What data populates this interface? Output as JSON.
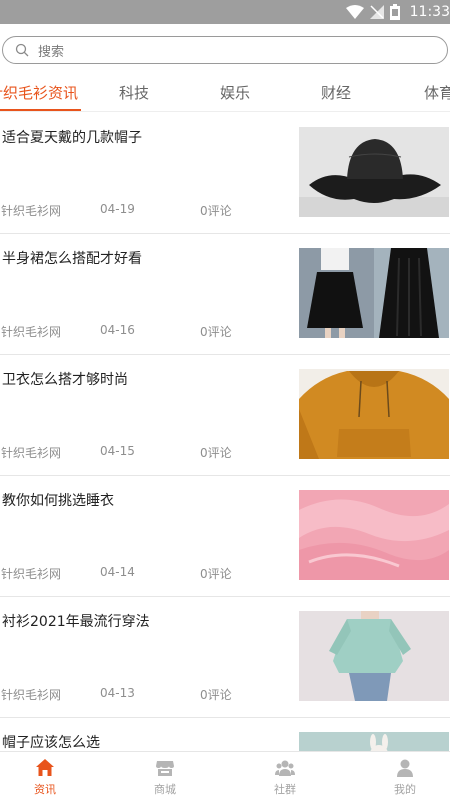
{
  "status_bar": {
    "time": "11:33"
  },
  "search": {
    "placeholder": "搜索"
  },
  "tabs": [
    {
      "label": "针织毛衫资讯",
      "active": true
    },
    {
      "label": "科技",
      "active": false
    },
    {
      "label": "娱乐",
      "active": false
    },
    {
      "label": "财经",
      "active": false
    },
    {
      "label": "体育",
      "active": false
    }
  ],
  "feed": [
    {
      "title": "适合夏天戴的几款帽子",
      "source": "针织毛衫网",
      "date": "04-19",
      "comments": "0评论",
      "image": "black-hat-photo"
    },
    {
      "title": "半身裙怎么搭配才好看",
      "source": "针织毛衫网",
      "date": "04-16",
      "comments": "0评论",
      "image": "skirt-outfit-photo"
    },
    {
      "title": "卫衣怎么搭才够时尚",
      "source": "针织毛衫网",
      "date": "04-15",
      "comments": "0评论",
      "image": "mustard-hoodie-photo"
    },
    {
      "title": "教你如何挑选睡衣",
      "source": "针织毛衫网",
      "date": "04-14",
      "comments": "0评论",
      "image": "pink-fleece-photo"
    },
    {
      "title": "衬衫2021年最流行穿法",
      "source": "针织毛衫网",
      "date": "04-13",
      "comments": "0评论",
      "image": "green-shirt-photo"
    },
    {
      "title": "帽子应该怎么选",
      "image": "bunny-hat-photo"
    }
  ],
  "bottom_nav": [
    {
      "label": "资讯",
      "icon": "home-icon",
      "active": true
    },
    {
      "label": "商城",
      "icon": "store-icon",
      "active": false
    },
    {
      "label": "社群",
      "icon": "community-icon",
      "active": false
    },
    {
      "label": "我的",
      "icon": "profile-icon",
      "active": false
    }
  ],
  "colors": {
    "accent": "#e8541c",
    "inactive": "#a3a3a3",
    "status_bar": "#9e9e9e"
  }
}
